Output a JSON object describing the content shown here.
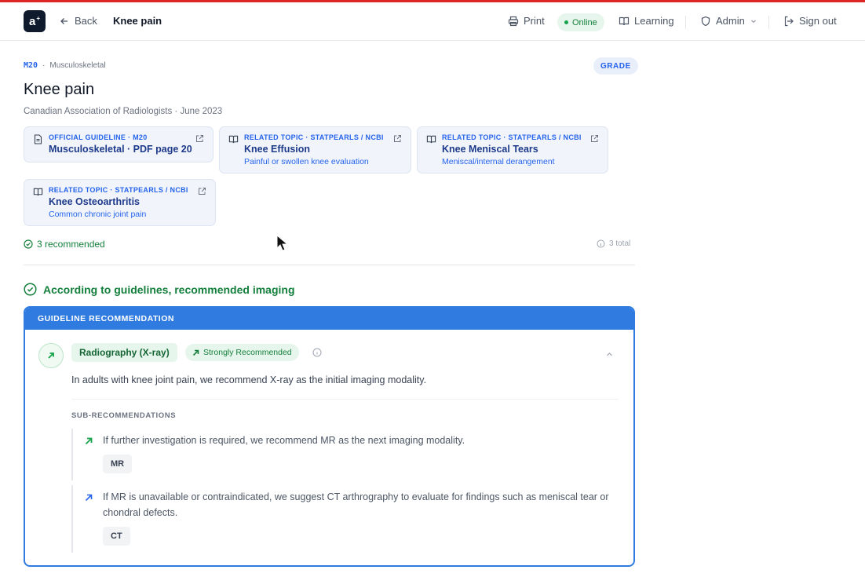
{
  "header": {
    "logo_text": "a",
    "back_label": "Back",
    "page_title": "Knee pain",
    "print_label": "Print",
    "online_label": "Online",
    "learning_label": "Learning",
    "admin_label": "Admin",
    "signout_label": "Sign out"
  },
  "topic": {
    "code": "M20",
    "category": "Musculoskeletal",
    "grade_label": "GRADE",
    "title": "Knee pain",
    "source": "Canadian Association of Radiologists · June 2023"
  },
  "cards": [
    {
      "icon": "document-icon",
      "kicker": "OFFICIAL GUIDELINE · M20",
      "title": "Musculoskeletal · PDF page 20",
      "subtitle": ""
    },
    {
      "icon": "book-icon",
      "kicker": "RELATED TOPIC · STATPEARLS / NCBI",
      "title": "Knee Effusion",
      "subtitle": "Painful or swollen knee evaluation"
    },
    {
      "icon": "book-icon",
      "kicker": "RELATED TOPIC · STATPEARLS / NCBI",
      "title": "Knee Meniscal Tears",
      "subtitle": "Meniscal/internal derangement"
    },
    {
      "icon": "book-icon",
      "kicker": "RELATED TOPIC · STATPEARLS / NCBI",
      "title": "Knee Osteoarthritis",
      "subtitle": "Common chronic joint pain"
    }
  ],
  "summary": {
    "recommended": "3 recommended",
    "total": "3 total"
  },
  "section": {
    "heading": "According to guidelines, recommended imaging"
  },
  "panel": {
    "header": "GUIDELINE RECOMMENDATION",
    "modality": "Radiography (X-ray)",
    "strength": "Strongly Recommended",
    "text": "In adults with knee joint pain, we recommend X-ray as the initial imaging modality.",
    "sub_heading": "SUB-RECOMMENDATIONS",
    "subs": [
      {
        "text": "If further investigation is required, we recommend MR as the next imaging modality.",
        "tag": "MR",
        "arrow_color": "#16a34a"
      },
      {
        "text": "If MR is unavailable or contraindicated, we suggest CT arthrography to evaluate for findings such as meniscal tear or chondral defects.",
        "tag": "CT",
        "arrow_color": "#2563eb"
      }
    ]
  },
  "colors": {
    "accent": "#2f7be0",
    "success": "#15803d",
    "top_line": "#dc2626"
  }
}
